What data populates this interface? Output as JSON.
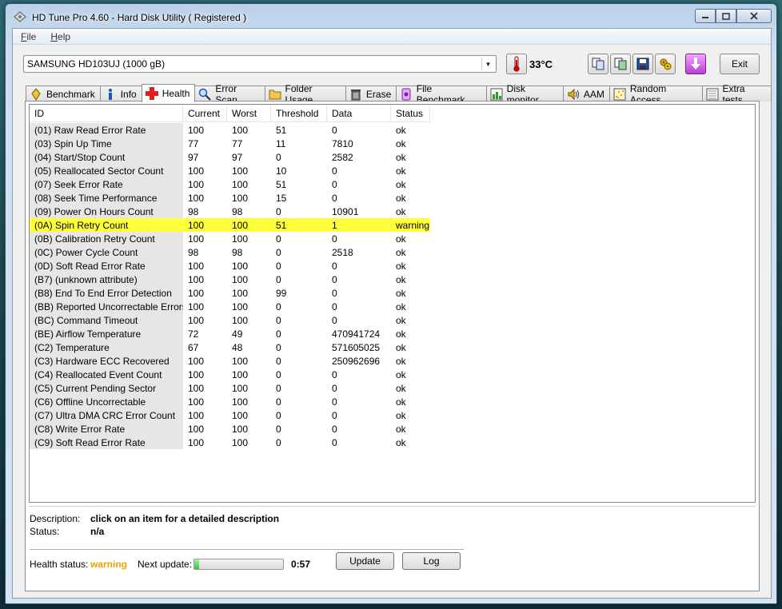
{
  "window": {
    "title": "HD Tune Pro 4.60 - Hard Disk Utility (  Registered )"
  },
  "menu": [
    "File",
    "Help"
  ],
  "toolbar": {
    "drive": "SAMSUNG HD103UJ (1000 gB)",
    "temperature": "33°C",
    "exit_label": "Exit",
    "icons": [
      "copy-text-icon",
      "copy-screenshot-icon",
      "save-icon",
      "options-icon",
      "download-icon"
    ]
  },
  "tabs": [
    {
      "label": "Benchmark",
      "icon": "benchmark-icon"
    },
    {
      "label": "Info",
      "icon": "info-icon"
    },
    {
      "label": "Health",
      "icon": "health-cross-icon",
      "active": true
    },
    {
      "label": "Error Scan",
      "icon": "magnifier-icon"
    },
    {
      "label": "Folder Usage",
      "icon": "folder-icon"
    },
    {
      "label": "Erase",
      "icon": "trash-icon"
    },
    {
      "label": "File Benchmark",
      "icon": "file-benchmark-icon"
    },
    {
      "label": "Disk monitor",
      "icon": "monitor-chart-icon"
    },
    {
      "label": "AAM",
      "icon": "speaker-icon"
    },
    {
      "label": "Random Access",
      "icon": "random-access-icon"
    },
    {
      "label": "Extra tests",
      "icon": "extra-tests-icon"
    }
  ],
  "table": {
    "columns": [
      "ID",
      "Current",
      "Worst",
      "Threshold",
      "Data",
      "Status"
    ],
    "rows": [
      [
        "(01) Raw Read Error Rate",
        "100",
        "100",
        "51",
        "0",
        "ok"
      ],
      [
        "(03) Spin Up Time",
        "77",
        "77",
        "11",
        "7810",
        "ok"
      ],
      [
        "(04) Start/Stop Count",
        "97",
        "97",
        "0",
        "2582",
        "ok"
      ],
      [
        "(05) Reallocated Sector Count",
        "100",
        "100",
        "10",
        "0",
        "ok"
      ],
      [
        "(07) Seek Error Rate",
        "100",
        "100",
        "51",
        "0",
        "ok"
      ],
      [
        "(08) Seek Time Performance",
        "100",
        "100",
        "15",
        "0",
        "ok"
      ],
      [
        "(09) Power On Hours Count",
        "98",
        "98",
        "0",
        "10901",
        "ok"
      ],
      [
        "(0A) Spin Retry Count",
        "100",
        "100",
        "51",
        "1",
        "warning"
      ],
      [
        "(0B) Calibration Retry Count",
        "100",
        "100",
        "0",
        "0",
        "ok"
      ],
      [
        "(0C) Power Cycle Count",
        "98",
        "98",
        "0",
        "2518",
        "ok"
      ],
      [
        "(0D) Soft Read Error Rate",
        "100",
        "100",
        "0",
        "0",
        "ok"
      ],
      [
        "(B7) (unknown attribute)",
        "100",
        "100",
        "0",
        "0",
        "ok"
      ],
      [
        "(B8) End To End Error Detection",
        "100",
        "100",
        "99",
        "0",
        "ok"
      ],
      [
        "(BB) Reported Uncorrectable Errors",
        "100",
        "100",
        "0",
        "0",
        "ok"
      ],
      [
        "(BC) Command Timeout",
        "100",
        "100",
        "0",
        "0",
        "ok"
      ],
      [
        "(BE) Airflow Temperature",
        "72",
        "49",
        "0",
        "470941724",
        "ok"
      ],
      [
        "(C2) Temperature",
        "67",
        "48",
        "0",
        "571605025",
        "ok"
      ],
      [
        "(C3) Hardware ECC Recovered",
        "100",
        "100",
        "0",
        "250962696",
        "ok"
      ],
      [
        "(C4) Reallocated Event Count",
        "100",
        "100",
        "0",
        "0",
        "ok"
      ],
      [
        "(C5) Current Pending Sector",
        "100",
        "100",
        "0",
        "0",
        "ok"
      ],
      [
        "(C6) Offline Uncorrectable",
        "100",
        "100",
        "0",
        "0",
        "ok"
      ],
      [
        "(C7) Ultra DMA CRC Error Count",
        "100",
        "100",
        "0",
        "0",
        "ok"
      ],
      [
        "(C8) Write Error Rate",
        "100",
        "100",
        "0",
        "0",
        "ok"
      ],
      [
        "(C9) Soft Read Error Rate",
        "100",
        "100",
        "0",
        "0",
        "ok"
      ]
    ]
  },
  "details": {
    "description_label": "Description:",
    "description_value": "click on an item for a detailed description",
    "status_label": "Status:",
    "status_value": "n/a"
  },
  "footer": {
    "health_label": "Health status:",
    "health_value": "warning",
    "next_update_label": "Next update:",
    "next_update_progress": 0.05,
    "time_remaining": "0:57",
    "update_label": "Update",
    "log_label": "Log"
  },
  "colors": {
    "warning_row": "#ffff3a",
    "warning_text": "#e8a400"
  }
}
